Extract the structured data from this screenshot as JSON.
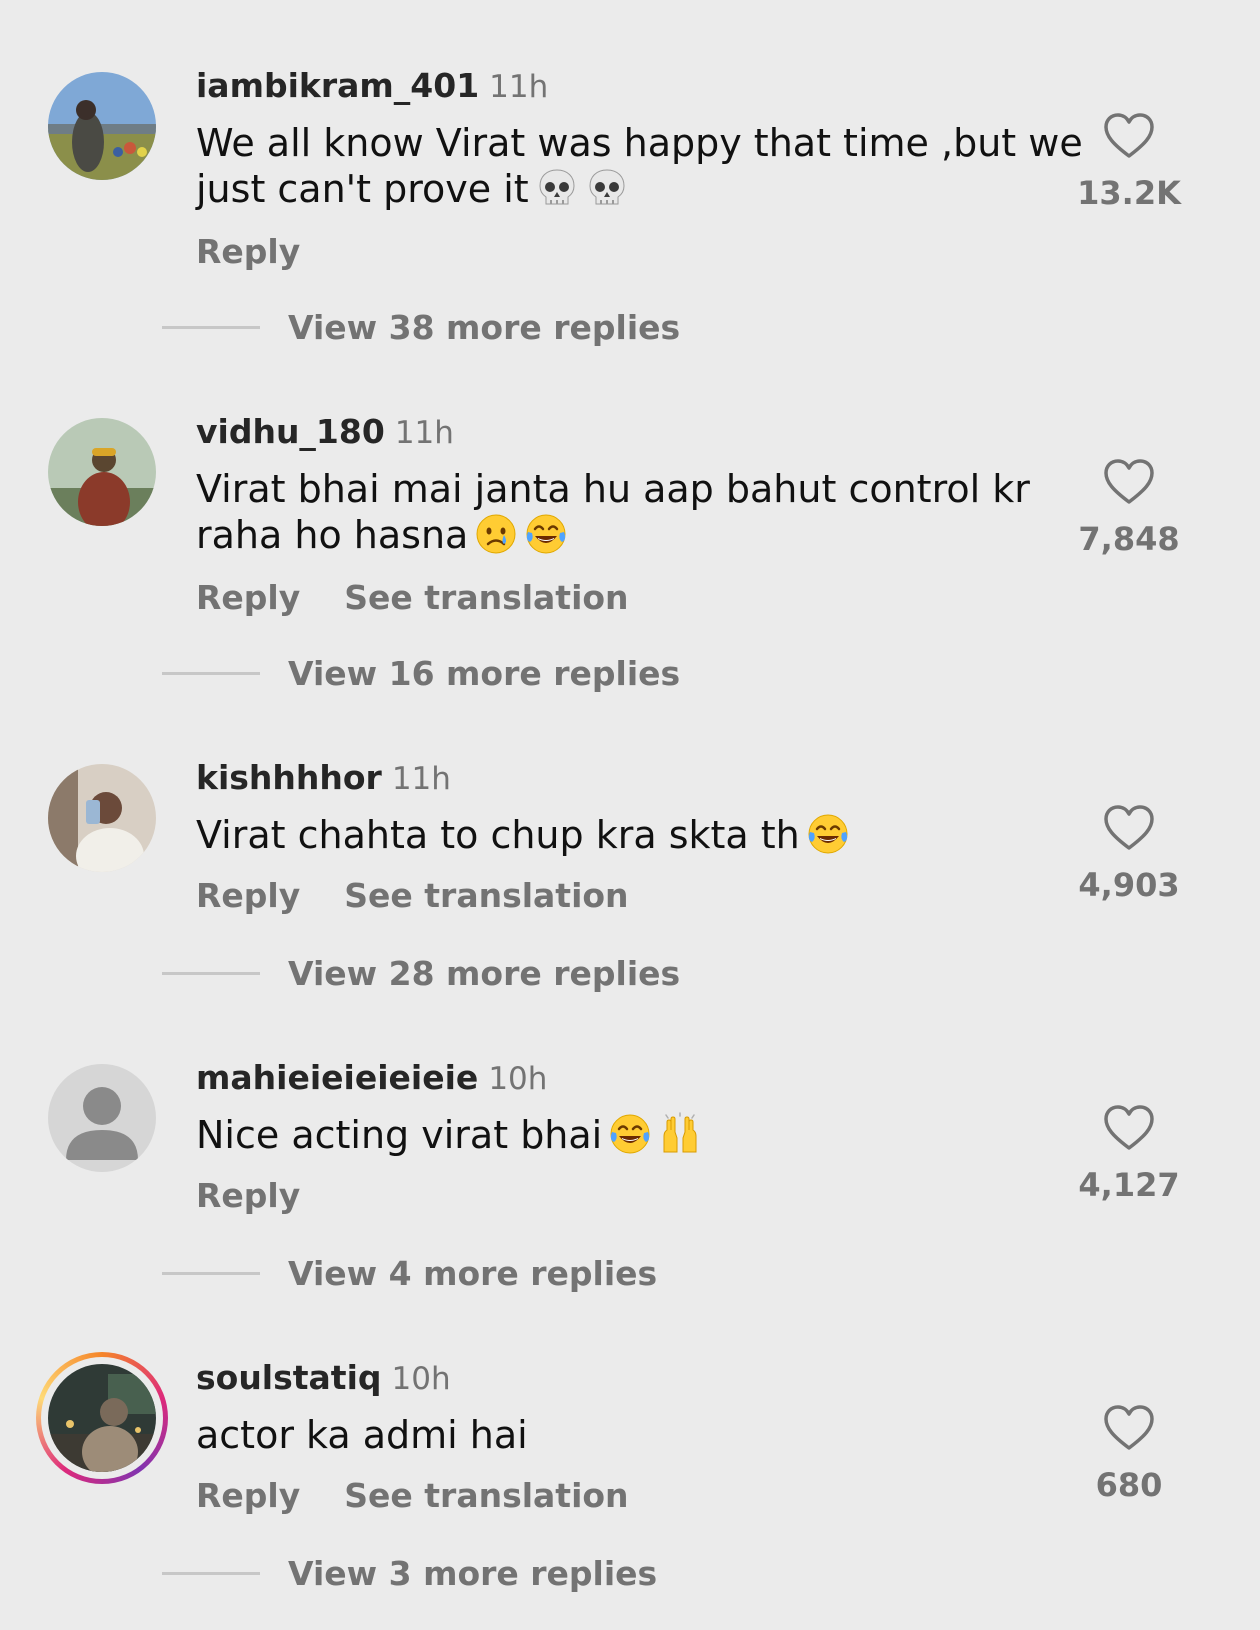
{
  "comments": [
    {
      "username": "iambikram_401",
      "time": "11h",
      "text": "We all know Virat was happy that time ,but we just can't prove it",
      "emojis": [
        "skull-emoji",
        "skull-emoji"
      ],
      "reply_label": "Reply",
      "like_count": "13.2K",
      "view_replies": "View 38 more replies",
      "avatar": "photo"
    },
    {
      "username": "vidhu_180",
      "time": "11h",
      "text": "Virat bhai mai janta hu aap bahut control kr raha ho hasna",
      "emojis": [
        "crying-face-emoji",
        "tears-of-joy-emoji"
      ],
      "reply_label": "Reply",
      "translation_label": "See translation",
      "like_count": "7,848",
      "view_replies": "View 16 more replies",
      "avatar": "photo"
    },
    {
      "username": "kishhhhor",
      "time": "11h",
      "text": "Virat chahta to chup kra skta th",
      "emojis": [
        "tears-of-joy-emoji"
      ],
      "reply_label": "Reply",
      "translation_label": "See translation",
      "like_count": "4,903",
      "view_replies": "View 28 more replies",
      "avatar": "photo"
    },
    {
      "username": "mahieieieieieie",
      "time": "10h",
      "text": "Nice acting virat bhai",
      "emojis": [
        "tears-of-joy-emoji",
        "raising-hands-emoji"
      ],
      "reply_label": "Reply",
      "like_count": "4,127",
      "view_replies": "View 4 more replies",
      "avatar": "default-person"
    },
    {
      "username": "soulstatiq",
      "time": "10h",
      "text": "actor ka admi hai",
      "emojis": [],
      "reply_label": "Reply",
      "translation_label": "See translation",
      "like_count": "680",
      "view_replies": "View 3 more replies",
      "avatar": "photo-with-story-ring"
    }
  ],
  "colors": {
    "background": "#ebebeb",
    "primary_text": "#111111",
    "secondary_text": "#737373",
    "username_text": "#262626",
    "story_ring_start": "#f58529",
    "story_ring_mid": "#dd2a7b"
  },
  "icons": {
    "like": "heart-outline-icon"
  }
}
